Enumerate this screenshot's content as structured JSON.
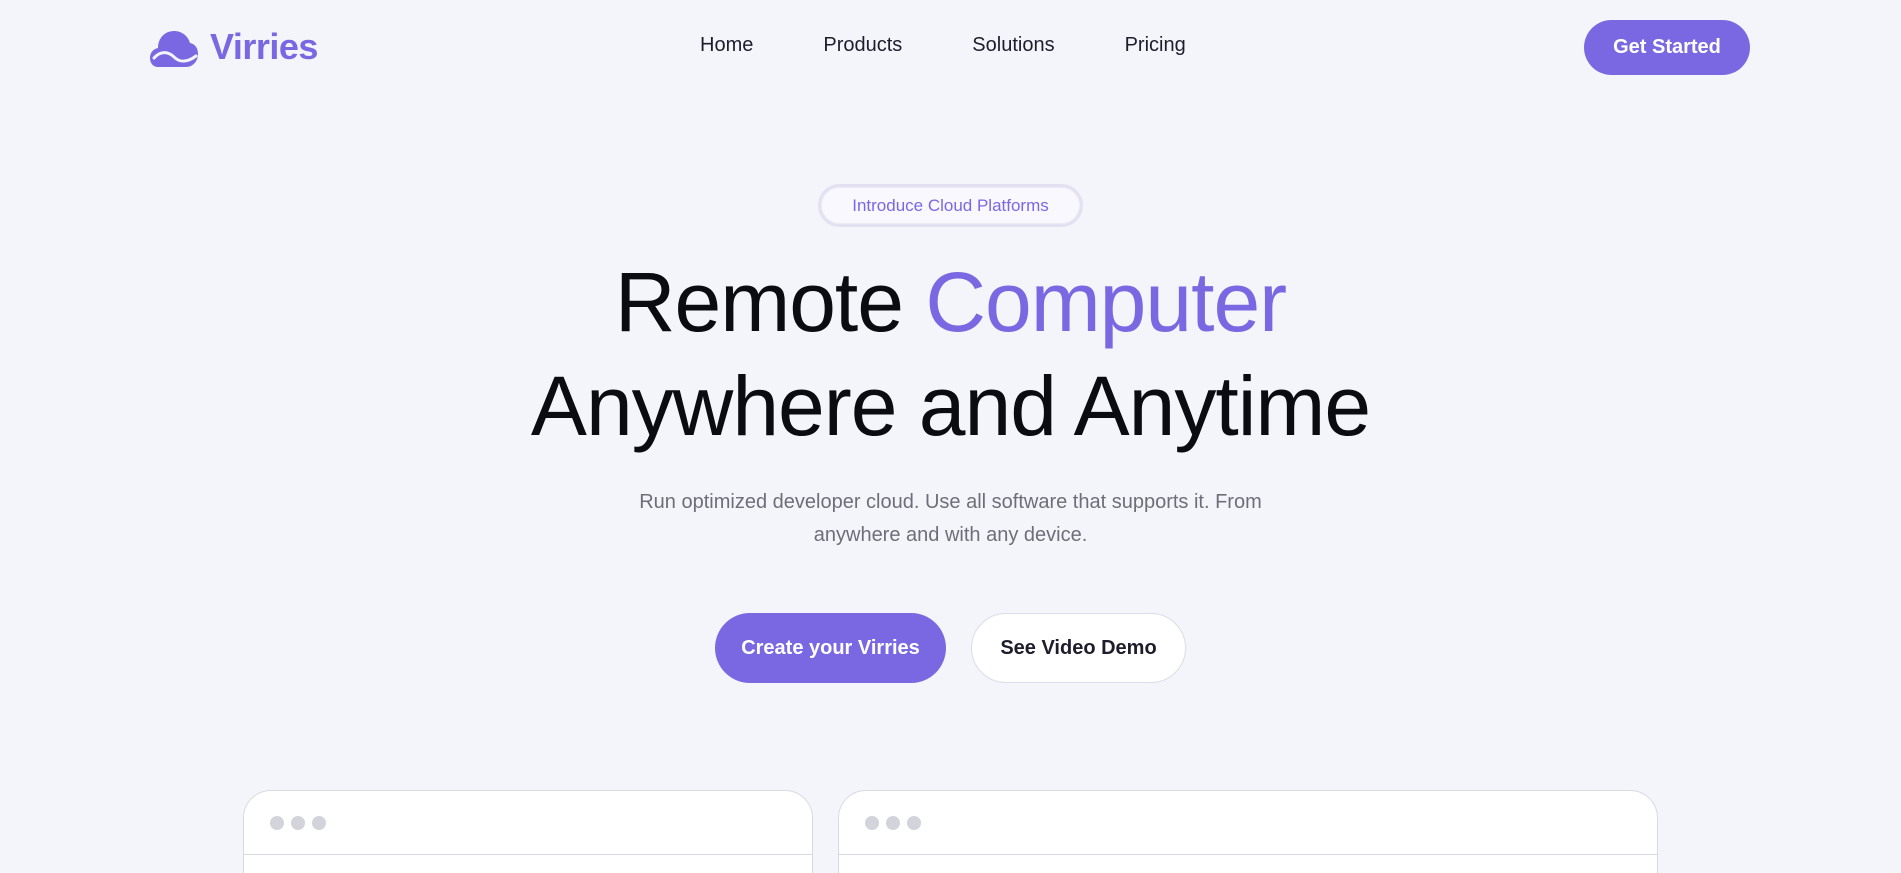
{
  "brand": {
    "name": "Virries",
    "icon": "cloud-icon",
    "color": "#7a68e3"
  },
  "nav": {
    "items": [
      {
        "label": "Home"
      },
      {
        "label": "Products"
      },
      {
        "label": "Solutions"
      },
      {
        "label": "Pricing"
      }
    ],
    "cta_label": "Get Started"
  },
  "hero": {
    "badge": "Introduce Cloud Platforms",
    "headline_part1": "Remote ",
    "headline_accent": "Computer",
    "headline_line2": "Anywhere and Anytime",
    "subtitle": "Run optimized developer cloud. Use all software that supports it. From anywhere and with any device.",
    "primary_button": "Create your Virries",
    "secondary_button": "See Video Demo"
  },
  "colors": {
    "accent": "#7a68e3",
    "background": "#f4f5fb",
    "text": "#0b0b12"
  }
}
